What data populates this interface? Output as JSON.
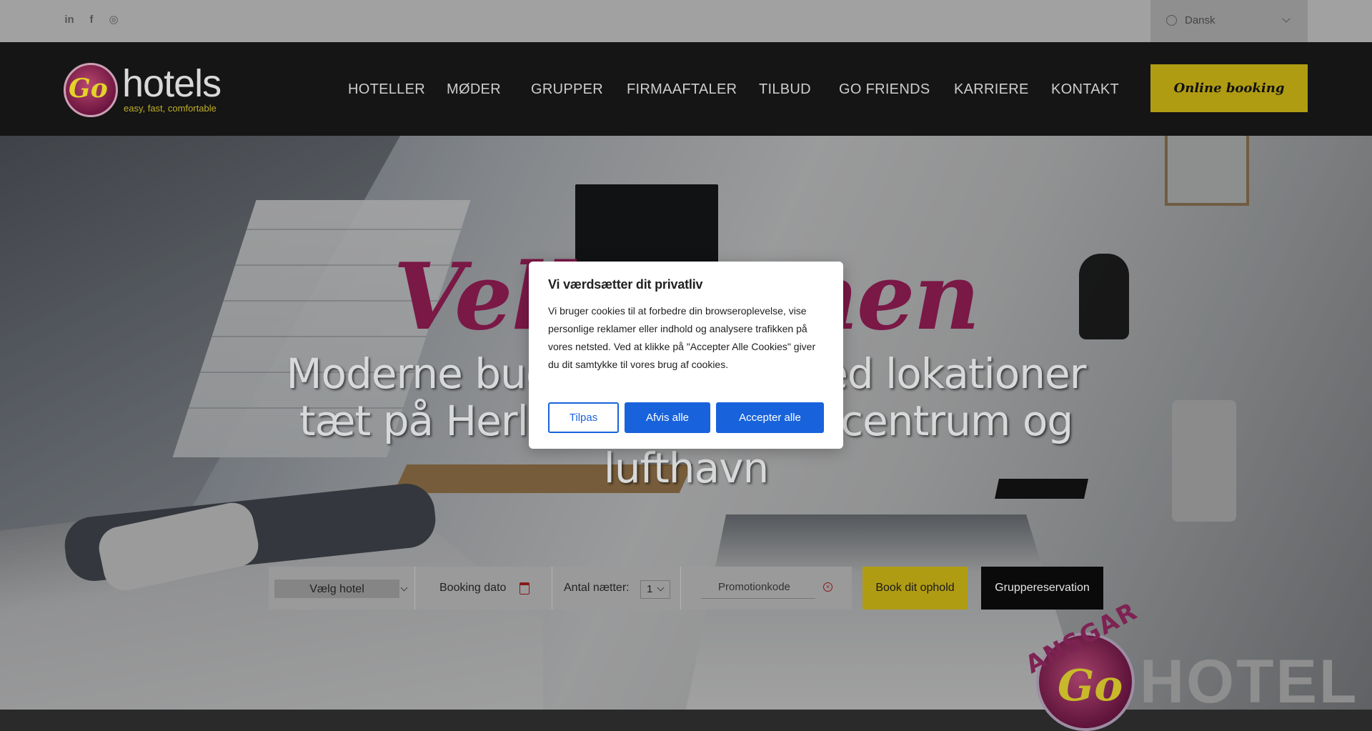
{
  "topbar": {
    "social": [
      {
        "name": "linkedin",
        "glyph": "in"
      },
      {
        "name": "facebook",
        "glyph": "f"
      },
      {
        "name": "instagram",
        "glyph": "◎"
      }
    ],
    "language": {
      "label": "Dansk"
    }
  },
  "header": {
    "logo": {
      "word": "hotels",
      "mark": "Go",
      "tagline": "easy, fast, comfortable"
    },
    "nav": [
      "HOTELLER",
      "MØDER",
      "GRUPPER",
      "FIRMAAFTALER",
      "TILBUD",
      "GO FRIENDS",
      "KARRIERE",
      "KONTAKT"
    ],
    "cta_label": "Online booking"
  },
  "hero": {
    "script_text": "Velkommen",
    "headline": "Moderne budgethoteller med lokationer tæt på Herlev, København centrum og lufthavn"
  },
  "booking": {
    "hotel_placeholder": "Vælg hotel",
    "date_label": "Booking dato",
    "nights_label": "Antal nætter:",
    "nights_value": "1",
    "promo_placeholder": "Promotionkode",
    "book_label": "Book dit ophold",
    "group_label": "Gruppereservation"
  },
  "badge": {
    "arc_text": "ANSGAR",
    "mark": "Go",
    "word": "HOTEL"
  },
  "cookie_modal": {
    "title": "Vi værdsætter dit privatliv",
    "body": "Vi bruger cookies til at forbedre din browseroplevelse, vise personlige reklamer eller indhold og analysere trafikken på vores netsted. Ved at klikke på \"Accepter Alle Cookies\" giver du dit samtykke til vores brug af cookies.",
    "customize_label": "Tilpas",
    "reject_label": "Afvis alle",
    "accept_label": "Accepter alle"
  },
  "colors": {
    "brand_yellow": "#b09c13",
    "brand_purple": "#7a1846",
    "cookie_blue": "#1863dc",
    "header_bg": "#151515"
  }
}
